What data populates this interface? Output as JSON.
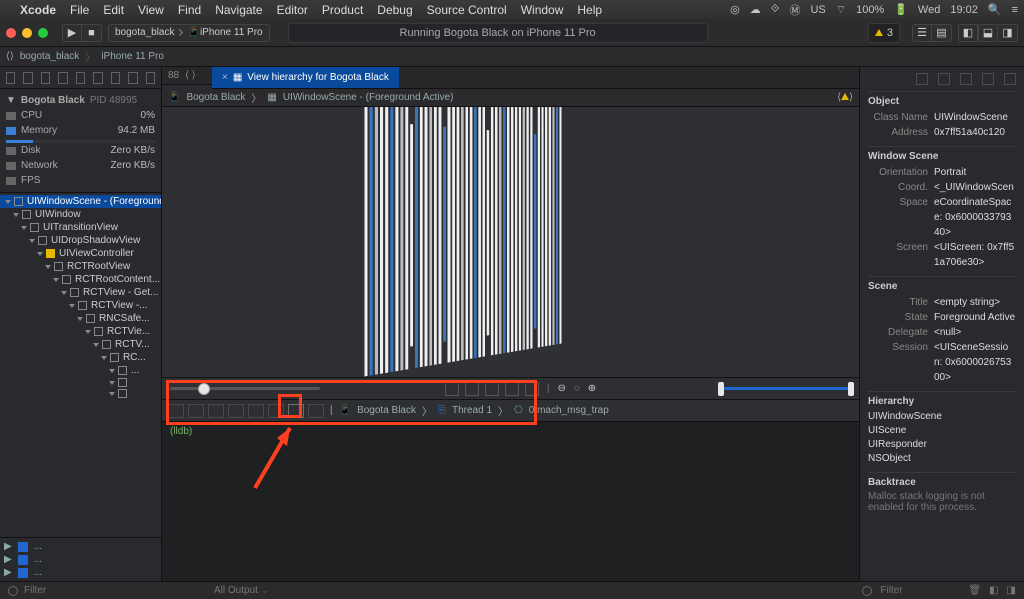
{
  "menubar": {
    "app": "Xcode",
    "items": [
      "File",
      "Edit",
      "View",
      "Find",
      "Navigate",
      "Editor",
      "Product",
      "Debug",
      "Source Control",
      "Window",
      "Help"
    ],
    "right": {
      "lang": "US",
      "wifi": "",
      "vol": "100%",
      "batt": "",
      "day": "Wed",
      "time": "19:02"
    }
  },
  "toolbar": {
    "scheme": "bogota_black",
    "device": "iPhone 11 Pro",
    "status": "Running Bogota Black on iPhone 11 Pro",
    "warn_count": "3"
  },
  "crumbs1": [
    "bogota_black",
    "iPhone 11 Pro"
  ],
  "leftbar": {
    "header": {
      "name": "Bogota Black",
      "pid": "PID 48995",
      "pct": "0%"
    },
    "stats": [
      {
        "name": "CPU",
        "value": "0%"
      },
      {
        "name": "Memory",
        "value": "94.2 MB"
      },
      {
        "name": "Disk",
        "value": "Zero KB/s"
      },
      {
        "name": "Network",
        "value": "Zero KB/s"
      },
      {
        "name": "FPS",
        "value": ""
      }
    ],
    "tree": [
      {
        "d": 0,
        "l": "UIWindowScene - (Foreground...",
        "sel": true
      },
      {
        "d": 1,
        "l": "UIWindow"
      },
      {
        "d": 2,
        "l": "UITransitionView"
      },
      {
        "d": 3,
        "l": "UIDropShadowView"
      },
      {
        "d": 4,
        "l": "UIViewController",
        "vc": true
      },
      {
        "d": 5,
        "l": "RCTRootView"
      },
      {
        "d": 6,
        "l": "RCTRootContent..."
      },
      {
        "d": 7,
        "l": "RCTView - Get..."
      },
      {
        "d": 8,
        "l": "RCTView -..."
      },
      {
        "d": 9,
        "l": "RNCSafe..."
      },
      {
        "d": 10,
        "l": "RCTVie..."
      },
      {
        "d": 11,
        "l": "RCTV..."
      },
      {
        "d": 12,
        "l": "RC..."
      },
      {
        "d": 13,
        "l": "..."
      },
      {
        "d": 13,
        "l": ""
      },
      {
        "d": 13,
        "l": ""
      }
    ]
  },
  "tab": {
    "title": "View hierarchy for Bogota Black"
  },
  "subcrumbs": [
    "Bogota Black",
    "UIWindowScene - (Foreground Active)"
  ],
  "debug_path": [
    "Bogota Black",
    "Thread 1",
    "0 mach_msg_trap"
  ],
  "console_prompt": "(lldb)",
  "all_output": "All Output",
  "filter_ph": "Filter",
  "inspector": {
    "object": {
      "title": "Object",
      "class_name": "UIWindowScene",
      "address": "0x7ff51a40c120"
    },
    "window_scene": {
      "title": "Window Scene",
      "orientation": "Portrait",
      "coord_space": "<_UIWindowSceneCoordinateSpace: 0x600003379340>",
      "screen": "<UIScreen: 0x7ff51a706e30>"
    },
    "scene": {
      "title": "Scene",
      "title_val": "<empty string>",
      "state": "Foreground Active",
      "delegate": "<null>",
      "session": "<UISceneSession: 0x600002675300>"
    },
    "hierarchy": {
      "title": "Hierarchy",
      "items": [
        "UIWindowScene",
        "UIScene",
        "UIResponder",
        "NSObject"
      ]
    },
    "backtrace": {
      "title": "Backtrace",
      "msg": "Malloc stack logging is not enabled for this process."
    }
  }
}
